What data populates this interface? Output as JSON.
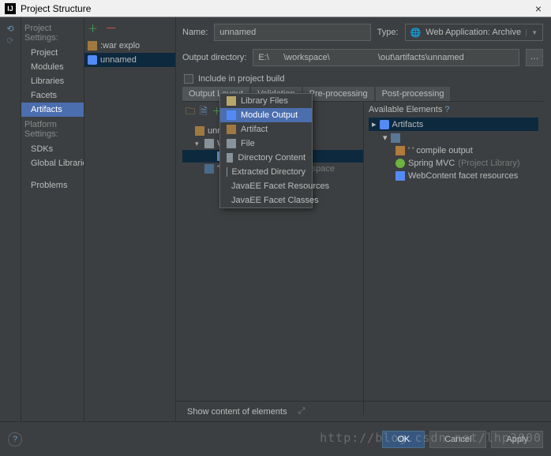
{
  "window": {
    "title": "Project Structure",
    "close": "×"
  },
  "sidebar": {
    "hdr1": "Project Settings:",
    "items1": [
      "Project",
      "Modules",
      "Libraries",
      "Facets",
      "Artifacts"
    ],
    "hdr2": "Platform Settings:",
    "items2": [
      "SDKs",
      "Global Libraries"
    ],
    "problems": "Problems"
  },
  "artifacts": {
    "list": [
      {
        "label": ":war explo",
        "sel": false
      },
      {
        "label": "unnamed",
        "sel": true
      }
    ]
  },
  "form": {
    "name_lbl": "Name:",
    "name_val": "unnamed",
    "type_lbl": "Type:",
    "type_val": "Web Application: Archive",
    "outdir_lbl": "Output directory:",
    "outdir_val": "E:\\      \\workspace\\                    \\out\\artifacts\\unnamed",
    "include_lbl": "Include in project build",
    "tabs": [
      "Output Layout",
      "Validation",
      "Pre-processing",
      "Post-processing"
    ]
  },
  "tree": {
    "nodes": [
      {
        "depth": 1,
        "icon": "arch",
        "label": "unnamed",
        "tri": ""
      },
      {
        "depth": 2,
        "icon": "fold",
        "label": "WEB-",
        "sel": false,
        "tri": "▾"
      },
      {
        "depth": 3,
        "icon": "fsel",
        "label": "cla",
        "sel": true,
        "tri": ""
      },
      {
        "depth": 2,
        "icon": "wc",
        "label": "'WebC",
        "tri": "",
        "suffix": "workspace"
      }
    ]
  },
  "available": {
    "hdr": "Available Elements",
    "q": "?",
    "nodes": [
      {
        "depth": 1,
        "icon": "blue",
        "label": "Artifacts",
        "tri": "▸",
        "sel": true
      },
      {
        "depth": 2,
        "icon": "mod",
        "label": "",
        "tri": "▾"
      },
      {
        "depth": 3,
        "icon": "orange",
        "label": "'                    ' compile output"
      },
      {
        "depth": 3,
        "icon": "spring",
        "label": "Spring MVC",
        "dim": "(Project Library)"
      },
      {
        "depth": 3,
        "icon": "web",
        "label": "WebContent facet resources"
      }
    ]
  },
  "menu": {
    "items": [
      {
        "icon": "lib",
        "label": "Library Files"
      },
      {
        "icon": "mod",
        "label": "Module Output",
        "sel": true
      },
      {
        "icon": "art",
        "label": "Artifact"
      },
      {
        "icon": "file",
        "label": "File"
      },
      {
        "icon": "dir",
        "label": "Directory Content"
      },
      {
        "icon": "ed",
        "label": "Extracted Directory"
      },
      {
        "icon": "jee",
        "label": "JavaEE Facet Resources"
      },
      {
        "icon": "jee",
        "label": "JavaEE Facet Classes"
      }
    ]
  },
  "bottom": {
    "show_content": "Show content of elements"
  },
  "footer": {
    "ok": "OK",
    "cancel": "Cancel",
    "apply": "Apply"
  },
  "watermark": "http://blog.csdn.net/lhp3000"
}
